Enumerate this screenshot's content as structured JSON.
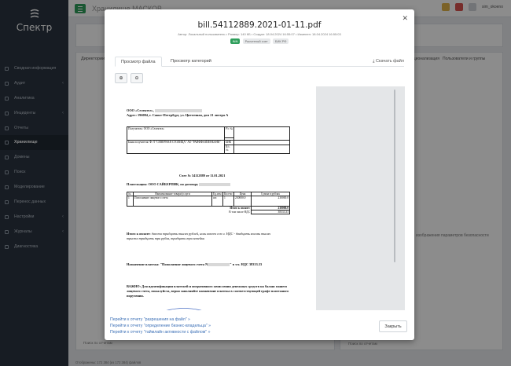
{
  "app": {
    "name": "Спектр",
    "title": "Хранилище МАСКОВ",
    "user": "sim_okoeno"
  },
  "sidebar": [
    {
      "label": "Сводная информация",
      "chev": ""
    },
    {
      "label": "Аудит",
      "chev": "‹"
    },
    {
      "label": "Аналитика",
      "chev": ""
    },
    {
      "label": "Инциденты",
      "chev": "‹"
    },
    {
      "label": "Отчеты",
      "chev": ""
    },
    {
      "label": "Хранилище",
      "chev": ""
    },
    {
      "label": "Домены",
      "chev": ""
    },
    {
      "label": "Поиск",
      "chev": ""
    },
    {
      "label": "Моделирование",
      "chev": ""
    },
    {
      "label": "Перенос данных",
      "chev": ""
    },
    {
      "label": "Настройки",
      "chev": "‹"
    },
    {
      "label": "Журналы",
      "chev": "‹"
    },
    {
      "label": "Диагностика",
      "chev": ""
    }
  ],
  "bg": {
    "dirs": "Директории",
    "panel_tab1": "ационализация",
    "panel_tab2": "Пользователи и группы",
    "hint": "изображения параметров безопасности",
    "footer": "Отображены: 172 384 (из 172 384) файлов",
    "filter_left": "Поиск по отчетам",
    "filter_right": "Поиск по отчетам"
  },
  "modal": {
    "title": "bill.54112889.2021-01-11.pdf",
    "meta": "Автор: Локальный пользователь • Размер: 140 КБ • Создан: 18.04.2024 16:55:07 • Изменен: 18.04.2024 16:55:03",
    "badges": [
      "INN",
      "Расчетный счет",
      "БИК РФ"
    ],
    "tabs": [
      "Просмотр файла",
      "Просмотр категорий"
    ],
    "download": "Скачать файл",
    "links": [
      "Перейти к отчету \"разрешения на файл\" »",
      "Перейти к отчету \"определение бизнес-владельца\" »",
      "Перейти к отчету \"таймлайн активности с файлом\" »"
    ],
    "close": "Закрыть"
  },
  "pdf": {
    "company": "ООО «Селектел»,",
    "address": "Адрес: 196084, г. Санкт-Петербург, ул. Цветочная, дом 21 литера А",
    "recipient": "Получатель: ООО «Селектел»",
    "bank": "Банк получателя: Ф-Л \"СЕВЕРНАЯ СТОЛИЦА\" АО \"РАЙФФАЙЗЕНБАНК\"",
    "rs": "Р/с №",
    "bik": "БИК",
    "ks": "К/с. №",
    "invoice": "Счет № 54112889 от 11.01.2021",
    "payer": "Плательщик: ООО САЙБЕРПИК, по договору",
    "th": [
      "№",
      "Наименование товара/услуги",
      "Ед.изм",
      "Кол-во",
      "Цена",
      "Сумма в рублях"
    ],
    "row": [
      "1",
      "Пополнение лицевого счета",
      "шт.",
      "1",
      "230000.0",
      "230000.0"
    ],
    "total_label": "Итого к оплате:",
    "total": "230000.0",
    "vat_label": "В том числе НДС",
    "vat": "38333.33",
    "words_label": "Итого к оплате:",
    "words": "двести тридцать тысяч рублей, ноль копеек в т.ч. НДС - двадцать восемь тысяч триста тридцать три рубля, тридцать три копейки",
    "purpose": "Назначение платежа: \"Пополнение лицевого счета N",
    "purpose_end": "\" в т.ч. НДС 38333.33",
    "important": "ВАЖНО: Для идентификации платежей и оперативного зачисления денежных средств на баланс вашего лицевого счета, пожалуйста, верно заполняйте назначение платежа в соответствующей графе платежного поручения."
  }
}
